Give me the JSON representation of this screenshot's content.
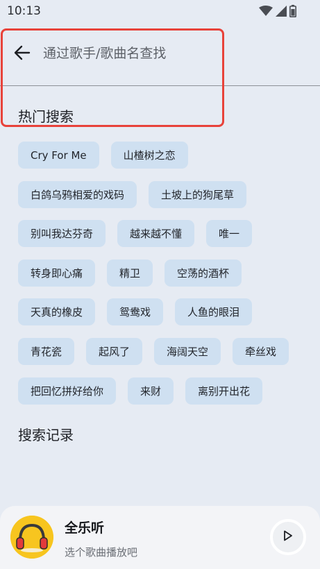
{
  "status_bar": {
    "time": "10:13",
    "icons": [
      "wifi-icon",
      "signal-icon",
      "battery-icon"
    ]
  },
  "search": {
    "placeholder": "通过歌手/歌曲名查找",
    "value": ""
  },
  "hot_search": {
    "title": "热门搜索",
    "rows": [
      [
        "Cry For Me",
        "山楂树之恋"
      ],
      [
        "白鸽乌鸦相爱的戏码",
        "土坡上的狗尾草"
      ],
      [
        "别叫我达芬奇",
        "越来越不懂",
        "唯一"
      ],
      [
        "转身即心痛",
        "精卫",
        "空荡的酒杯"
      ],
      [
        "天真的橡皮",
        "鸳鸯戏",
        "人鱼的眼泪"
      ],
      [
        "青花瓷",
        "起风了",
        "海阔天空",
        "牵丝戏"
      ],
      [
        "把回忆拼好给你",
        "来财",
        "离别开出花"
      ]
    ]
  },
  "history": {
    "title": "搜索记录"
  },
  "player": {
    "app_name": "全乐听",
    "hint": "选个歌曲播放吧"
  },
  "colors": {
    "background": "#e6ebf3",
    "tag_background": "#cfe0f1",
    "highlight_border": "#e8423a",
    "cover_yellow": "#f7c51f"
  }
}
